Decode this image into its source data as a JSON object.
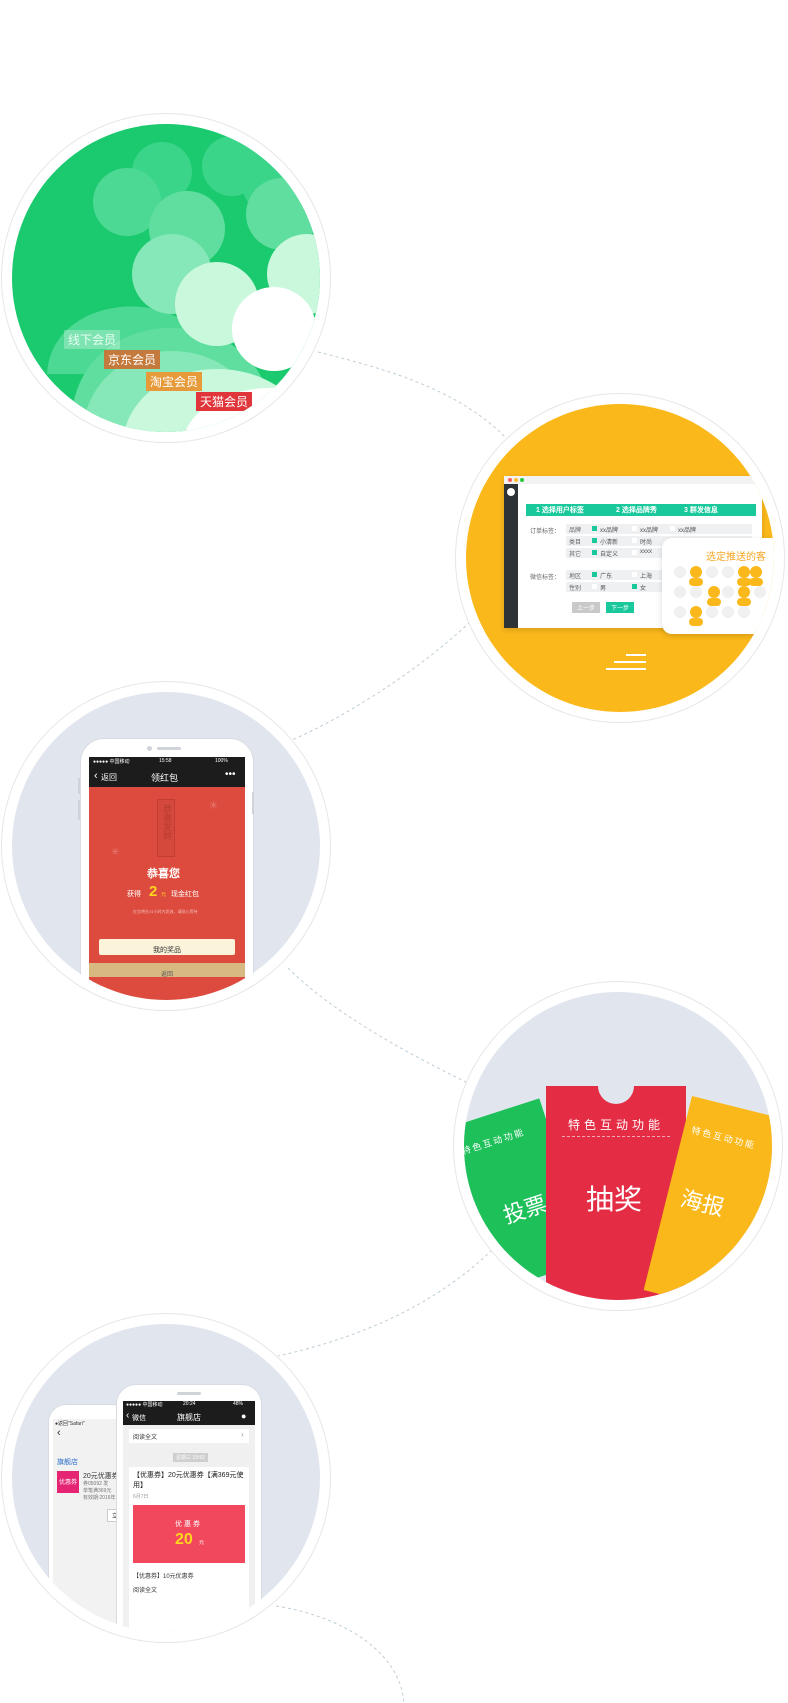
{
  "members": {
    "offline": "线下会员",
    "jd": "京东会员",
    "taobao": "淘宝会员",
    "tmall": "天猫会员",
    "colors": {
      "bg": "#1bc96e",
      "jd": "#c47a3c",
      "taobao": "#e69a3a",
      "tmall": "#e0353a"
    }
  },
  "tagging": {
    "steps": [
      "1 选择用户标签",
      "2 选择品牌秀",
      "3 群发信息"
    ],
    "order_label": "订单标签：",
    "rows": [
      {
        "name": "品牌",
        "a": "xx品牌",
        "b": "xx品牌",
        "c": "xx品牌"
      },
      {
        "name": "类目",
        "a": "小清新",
        "b": "时尚",
        "c": "成熟"
      },
      {
        "name": "其它",
        "a": "自定义",
        "b": "xxxx",
        "c": "xxxx"
      }
    ],
    "wechat_label": "微信标签：",
    "region": {
      "name": "地区",
      "a": "广东",
      "b": "上海"
    },
    "gender": {
      "name": "性别",
      "a": "男",
      "b": "女"
    },
    "prev_button": "上一步",
    "next_button": "下一步",
    "popup_title": "选定推送的客",
    "accent": "#19c89b"
  },
  "redpacket": {
    "status_carrier": "●●●●● 中国移动",
    "status_time": "15:58",
    "status_battery": "100%",
    "back": "返回",
    "title": "领红包",
    "stamp": "恭喜发财",
    "congrats": "恭喜您",
    "got_prefix": "获得",
    "amount": "2",
    "unit": "元",
    "got_suffix": "现金红包",
    "note": "红包将在24小时内发放，请耐心等待",
    "prize_button": "我的奖品",
    "return_button": "返回",
    "color": "#dd4b3e"
  },
  "features": {
    "title": "特色互动功能",
    "vote": "投票",
    "lottery": "抽奖",
    "poster": "海报",
    "left_header": "特色互动功能",
    "right_header": "特色互动功能",
    "colors": {
      "vote": "#1ec05a",
      "lottery": "#e42c45",
      "poster": "#fbb81b"
    }
  },
  "store": {
    "back_phone": {
      "status": "●返回\"Safari\"",
      "status_time": "20",
      "shop_label": "旗舰店",
      "title_cut": "旗",
      "coupon_badge": "优惠券",
      "coupon_title": "20元优惠券",
      "coupon_line1": "券05092 发",
      "coupon_line2": "单笔满369元",
      "coupon_line3": "有效期:2016年",
      "claim_button": "立刻领"
    },
    "front_phone": {
      "status_carrier": "●●●●● 中国移动",
      "status_time": "20:24",
      "status_battery": "48%",
      "back": "微信",
      "title": "旗舰店",
      "read_full": "阅读全文",
      "date_badge": "星期三 19:52",
      "headline": "【优惠券】20元优惠券【满369元使用】",
      "date": "6月7日",
      "coupon_label": "优惠券",
      "coupon_amount": "20",
      "coupon_unit": "元",
      "footer_item": "【优惠券】10元优惠券",
      "footer_read": "阅读全文"
    }
  }
}
